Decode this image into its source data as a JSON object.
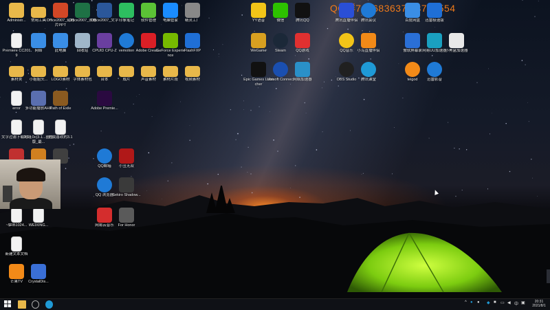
{
  "overlay": {
    "text": "QQ群747683637   78780554"
  },
  "desktop_icons": [
    {
      "label": "Administr...",
      "icon": "user-folder-icon",
      "color": "#e8b84a"
    },
    {
      "label": "常用工具",
      "icon": "folder-icon",
      "color": "#e8b84a"
    },
    {
      "label": "Office2007_幻灯片PPT",
      "icon": "powerpoint-icon",
      "color": "#d24726"
    },
    {
      "label": "Office2007_表格",
      "icon": "excel-icon",
      "color": "#1e7145"
    },
    {
      "label": "Office2007_文字",
      "icon": "word-icon",
      "color": "#2b579a"
    },
    {
      "label": "印象笔记",
      "icon": "evernote-icon",
      "color": "#2dbe60"
    },
    {
      "label": "软件管理",
      "icon": "software-manager-icon",
      "color": "#5bc236"
    },
    {
      "label": "电脑管家",
      "icon": "pc-manager-icon",
      "color": "#1a8cff"
    },
    {
      "label": "精灵工厂",
      "icon": "factory-icon",
      "color": "#888888"
    },
    {
      "label": "Premiere CC2019",
      "icon": "document-icon",
      "color": "#f2f2f2"
    },
    {
      "label": "网络",
      "icon": "network-icon",
      "color": "#3a8ee6"
    },
    {
      "label": "此电脑",
      "icon": "computer-icon",
      "color": "#3a8ee6"
    },
    {
      "label": "回收站",
      "icon": "recycle-bin-icon",
      "color": "#9fb6c9"
    },
    {
      "label": "CPUID CPU-Z",
      "icon": "cpuz-icon",
      "color": "#6a3fa0"
    },
    {
      "label": "vemotion",
      "icon": "vemotion-icon",
      "color": "#1f7ad6"
    },
    {
      "label": "Adobe Creati...",
      "icon": "adobe-cc-icon",
      "color": "#da1f26"
    },
    {
      "label": "GeForce Experience",
      "icon": "geforce-icon",
      "color": "#76b900"
    },
    {
      "label": "FlashFXP",
      "icon": "flashfxp-icon",
      "color": "#1f6fd6"
    },
    {
      "label": "素材类",
      "icon": "folder-icon",
      "color": "#e8b84a"
    },
    {
      "label": "小姐姐头...",
      "icon": "folder-icon",
      "color": "#e8b84a"
    },
    {
      "label": "LOGO素材",
      "icon": "folder-icon",
      "color": "#e8b84a"
    },
    {
      "label": "字体素材包",
      "icon": "folder-icon",
      "color": "#e8b84a"
    },
    {
      "label": "台本",
      "icon": "folder-icon",
      "color": "#e8b84a"
    },
    {
      "label": "成片",
      "icon": "folder-icon",
      "color": "#e8b84a"
    },
    {
      "label": "声音素材",
      "icon": "folder-icon",
      "color": "#e8b84a"
    },
    {
      "label": "素材片段",
      "icon": "folder-icon",
      "color": "#e8b84a"
    },
    {
      "label": "视频素材",
      "icon": "folder-icon",
      "color": "#e8b84a"
    },
    {
      "label": "error",
      "icon": "document-icon",
      "color": "#f2f2f2"
    },
    {
      "label": "多功能播放AHK",
      "icon": "ahk-icon",
      "color": "#5a6fb0"
    },
    {
      "label": "Path of Exile",
      "icon": "poe-icon",
      "color": "#8a5a20"
    },
    {
      "label": "Adobe Premie...",
      "icon": "premiere-icon",
      "color": "#2a0a40"
    },
    {
      "label": "文字过滤下载地址",
      "icon": "document-icon",
      "color": "#f2f2f2"
    },
    {
      "label": "3.14.0c(3.1...圈圈版_最...",
      "icon": "document-icon",
      "color": "#f2f2f2"
    },
    {
      "label": "的我喜欢的3.1",
      "icon": "document-icon",
      "color": "#f2f2f2"
    },
    {
      "label": "",
      "icon": "app-grid-icon",
      "color": "#c03030"
    },
    {
      "label": "",
      "icon": "app-icon",
      "color": "#d08020"
    },
    {
      "label": "",
      "icon": "app-icon",
      "color": "#404040"
    },
    {
      "label": "QQ邮箱",
      "icon": "qq-mail-icon",
      "color": "#1f7ad6"
    },
    {
      "label": "小丑无双",
      "icon": "joker-icon",
      "color": "#b01818"
    },
    {
      "label": "QQ 浏览器",
      "icon": "qq-browser-icon",
      "color": "#1f7ad6"
    },
    {
      "label": "Sekiro Shadow...",
      "icon": "sekiro-icon",
      "color": "#3a3a3a"
    },
    {
      "label": "~$RB1024...",
      "icon": "document-icon",
      "color": "#f2f2f2"
    },
    {
      "label": "WEIXING...",
      "icon": "document-icon",
      "color": "#f2f2f2"
    },
    {
      "label": "网易云音乐",
      "icon": "netease-music-icon",
      "color": "#d42d2d"
    },
    {
      "label": "For Honor",
      "icon": "for-honor-icon",
      "color": "#5a5a5a"
    },
    {
      "label": "新建文本文档",
      "icon": "document-icon",
      "color": "#f2f2f2"
    },
    {
      "label": "芒果TV",
      "icon": "mango-tv-icon",
      "color": "#f28a18"
    },
    {
      "label": "CrystalDis...",
      "icon": "crystaldisk-icon",
      "color": "#3a6fd6"
    },
    {
      "label": "YY语音",
      "icon": "yy-icon",
      "color": "#f2c418"
    },
    {
      "label": "微信",
      "icon": "wechat-icon",
      "color": "#2dc100"
    },
    {
      "label": "腾讯QQ",
      "icon": "qq-icon",
      "color": "#111111"
    },
    {
      "label": "腾讯直播伴侣",
      "icon": "live-icon",
      "color": "#2a4fd6"
    },
    {
      "label": "腾讯会议",
      "icon": "meeting-icon",
      "color": "#1f7ad6"
    },
    {
      "label": "百度网盘",
      "icon": "baidu-netdisk-icon",
      "color": "#3a8ee6"
    },
    {
      "label": "迅雷极速版",
      "icon": "thunder-icon",
      "color": "#1f6fd6"
    },
    {
      "label": "WeGame",
      "icon": "wegame-icon",
      "color": "#d8a020"
    },
    {
      "label": "Steam",
      "icon": "steam-icon",
      "color": "#1b2838"
    },
    {
      "label": "QQ游戏",
      "icon": "qq-game-icon",
      "color": "#e03030"
    },
    {
      "label": "QQ音乐",
      "icon": "qq-music-icon",
      "color": "#f2c418"
    },
    {
      "label": "小鸟直播伴侣",
      "icon": "bird-live-icon",
      "color": "#f28a18"
    },
    {
      "label": "傲软屏幕录",
      "icon": "recorder-icon",
      "color": "#2a6fd6"
    },
    {
      "label": "网易UU加速器",
      "icon": "uu-icon",
      "color": "#1aa0c0"
    },
    {
      "label": "小黑盒加速器",
      "icon": "heybox-icon",
      "color": "#e8e8e8"
    },
    {
      "label": "Epic Games Launcher",
      "icon": "epic-icon",
      "color": "#111111"
    },
    {
      "label": "Ubisoft Connect",
      "icon": "ubisoft-icon",
      "color": "#1a4fb0"
    },
    {
      "label": "网络加速器",
      "icon": "accelerator-icon",
      "color": "#2a90c8"
    },
    {
      "label": "OBS Studio",
      "icon": "obs-icon",
      "color": "#202020"
    },
    {
      "label": "腾讯课堂",
      "icon": "classroom-icon",
      "color": "#1f9ad6"
    },
    {
      "label": "teigod",
      "icon": "teigod-icon",
      "color": "#f28a18"
    },
    {
      "label": "迅雷影音",
      "icon": "thunder-player-icon",
      "color": "#1f7ad6"
    }
  ],
  "taskbar": {
    "time": "20:31",
    "date": "2021/8/1",
    "lang": "中"
  }
}
